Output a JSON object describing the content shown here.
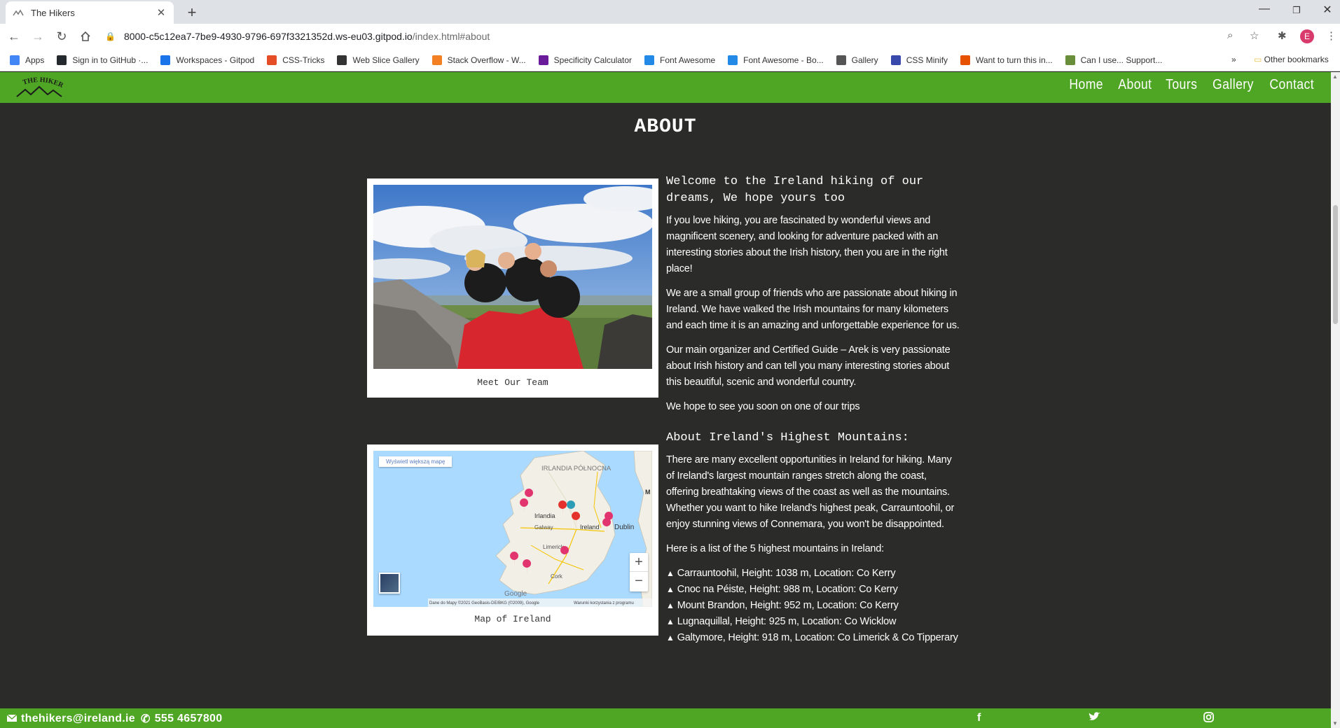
{
  "browser": {
    "tab_title": "The Hikers",
    "url_host": "8000-c5c12ea7-7be9-4930-9796-697f3321352d.ws-eu03.gitpod.io",
    "url_path": "/index.html#about",
    "profile_initial": "E",
    "bookmarks": [
      {
        "label": "Apps",
        "color": "#4285f4"
      },
      {
        "label": "Sign in to GitHub ·...",
        "color": "#24292e"
      },
      {
        "label": "Workspaces - Gitpod",
        "color": "#1a73e8"
      },
      {
        "label": "CSS-Tricks",
        "color": "#e44d26"
      },
      {
        "label": "Web Slice Gallery",
        "color": "#333333"
      },
      {
        "label": "Stack Overflow - W...",
        "color": "#f48024"
      },
      {
        "label": "Specificity Calculator",
        "color": "#6a1b9a"
      },
      {
        "label": "Font Awesome",
        "color": "#228ae6"
      },
      {
        "label": "Font Awesome - Bo...",
        "color": "#228ae6"
      },
      {
        "label": "Gallery",
        "color": "#555555"
      },
      {
        "label": "CSS Minify",
        "color": "#3949ab"
      },
      {
        "label": "Want to turn this in...",
        "color": "#e65100"
      },
      {
        "label": "Can I use... Support...",
        "color": "#6a8f3a"
      }
    ],
    "other_bookmarks": "Other bookmarks"
  },
  "site": {
    "logo_text": "THE HIKERS",
    "nav": [
      "Home",
      "About",
      "Tours",
      "Gallery",
      "Contact"
    ],
    "colors": {
      "header": "#4fa624",
      "background": "#2b2b29"
    }
  },
  "about": {
    "title": "ABOUT",
    "team_caption": "Meet Our Team",
    "map_caption": "Map of Ireland",
    "welcome_heading": "Welcome to the Ireland hiking of our dreams, We hope yours too",
    "paragraphs": [
      "If you love hiking, you are fascinated by wonderful views and magnificent scenery, and looking for adventure packed with an interesting stories about the Irish history, then you are in the right place!",
      "We are a small group of friends who are passionate about hiking in Ireland. We have walked the Irish mountains for many kilometers and each time it is an amazing and unforgettable experience for us.",
      "Our main organizer and Certified Guide – Arek is very passionate about Irish history and can tell you many interesting stories about this beautiful, scenic and wonderful country.",
      "We hope to see you soon on one of our trips"
    ],
    "mountains_heading": "About Ireland's Highest Mountains:",
    "mountains_intro": "There are many excellent opportunities in Ireland for hiking. Many of Ireland's largest mountain ranges stretch along the coast, offering breathtaking views of the coast as well as the mountains. Whether you want to hike Ireland's highest peak, Carrauntoohil, or enjoy stunning views of Connemara, you won't be disappointed.",
    "list_intro": "Here is a list of the 5 highest mountains in Ireland:",
    "mountains": [
      "Carrauntoohil, Height: 1038 m, Location: Co Kerry",
      "Cnoc na Péiste, Height: 988 m, Location: Co Kerry",
      "Mount Brandon, Height: 952 m, Location: Co Kerry",
      "Lugnaquillal, Height: 925 m, Location: Co Wicklow",
      "Galtymore, Height: 918 m, Location: Co Limerick & Co Tipperary"
    ]
  },
  "map": {
    "view_larger": "Wyświetl większą mapę",
    "label_ni": "IRLANDIA PÓŁNOCNA",
    "label_irlandia": "Irlandia",
    "label_galway": "Galway",
    "label_ireland": "Ireland",
    "label_dublin": "Dublin",
    "label_limerick": "Limerick",
    "label_cork": "Cork",
    "label_m": "M",
    "google": "Google",
    "attribution": "Dane do Mapy ©2021 GeoBasis-DE/BKG (©2009), Google",
    "terms": "Warunki korzystania z programu",
    "zoom_in": "+",
    "zoom_out": "−"
  },
  "footer": {
    "email": "thehikers@ireland.ie",
    "phone": "555 4657800"
  }
}
